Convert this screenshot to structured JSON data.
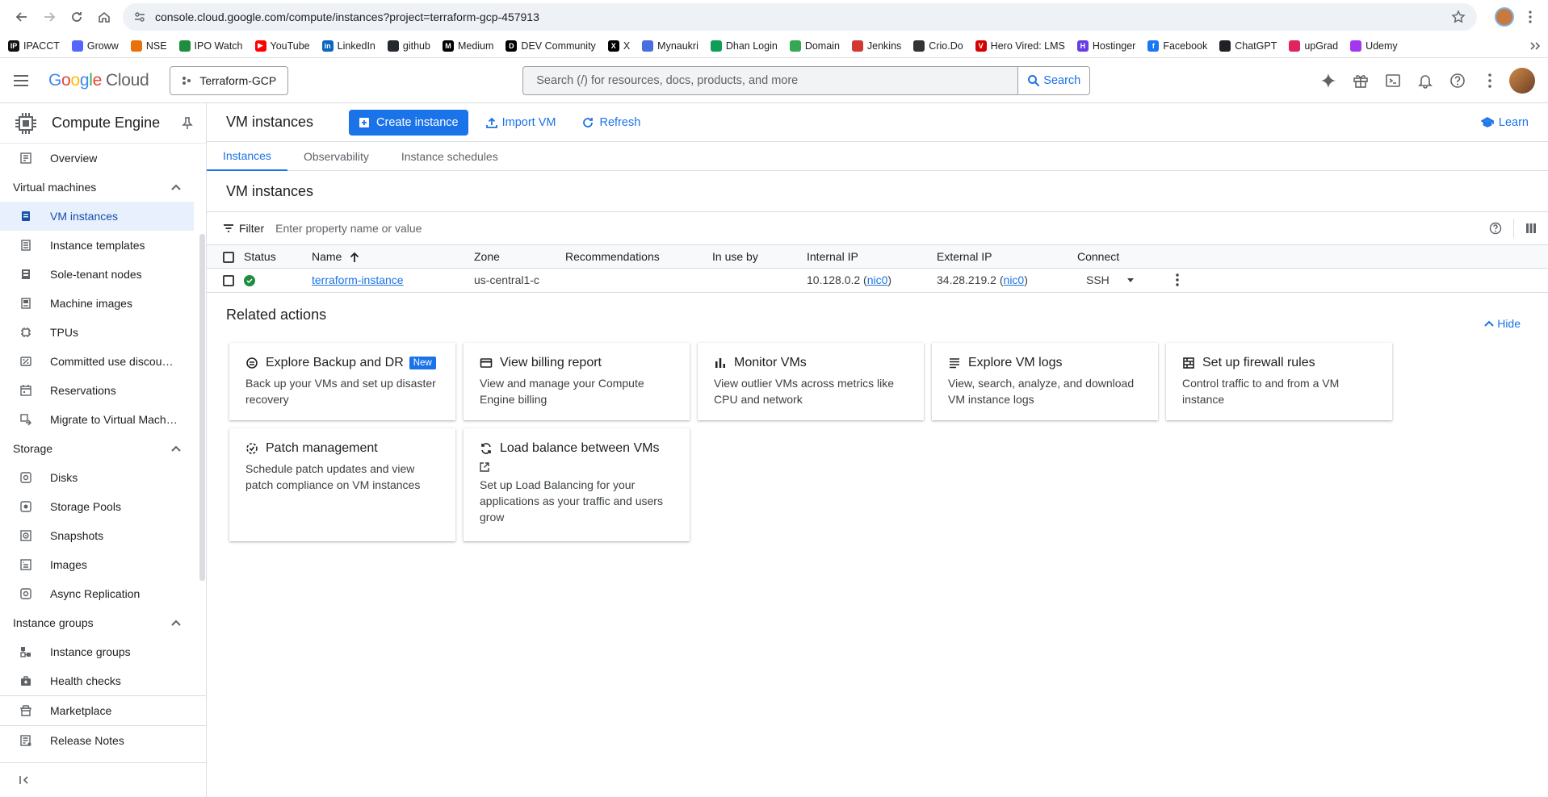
{
  "browser": {
    "url": "console.cloud.google.com/compute/instances?project=terraform-gcp-457913",
    "bookmarks": [
      {
        "label": "IPACCT",
        "color": "#111111",
        "glyph": "IP"
      },
      {
        "label": "Groww",
        "color": "#5367ff",
        "glyph": ""
      },
      {
        "label": "NSE",
        "color": "#e8710a",
        "glyph": ""
      },
      {
        "label": "IPO Watch",
        "color": "#1e8e3e",
        "glyph": ""
      },
      {
        "label": "YouTube",
        "color": "#ff0000",
        "glyph": "▶"
      },
      {
        "label": "LinkedIn",
        "color": "#0a66c2",
        "glyph": "in"
      },
      {
        "label": "github",
        "color": "#24292f",
        "glyph": ""
      },
      {
        "label": "Medium",
        "color": "#000000",
        "glyph": "M"
      },
      {
        "label": "DEV Community",
        "color": "#000000",
        "glyph": "D"
      },
      {
        "label": "X",
        "color": "#000000",
        "glyph": "X"
      },
      {
        "label": "Mynaukri",
        "color": "#4a6ee0",
        "glyph": ""
      },
      {
        "label": "Dhan Login",
        "color": "#0f9d58",
        "glyph": ""
      },
      {
        "label": "Domain",
        "color": "#34a853",
        "glyph": ""
      },
      {
        "label": "Jenkins",
        "color": "#d33833",
        "glyph": ""
      },
      {
        "label": "Crio.Do",
        "color": "#333333",
        "glyph": ""
      },
      {
        "label": "Hero Vired: LMS",
        "color": "#d50000",
        "glyph": "V"
      },
      {
        "label": "Hostinger",
        "color": "#673de6",
        "glyph": "H"
      },
      {
        "label": "Facebook",
        "color": "#1877f2",
        "glyph": "f"
      },
      {
        "label": "ChatGPT",
        "color": "#202124",
        "glyph": ""
      },
      {
        "label": "upGrad",
        "color": "#e0245e",
        "glyph": ""
      },
      {
        "label": "Udemy",
        "color": "#a435f0",
        "glyph": ""
      }
    ]
  },
  "header": {
    "logo_google": "Google",
    "logo_cloud": "Cloud",
    "project": "Terraform-GCP",
    "search_placeholder": "Search (/) for resources, docs, products, and more",
    "search_button": "Search"
  },
  "sidebar": {
    "product": "Compute Engine",
    "overview": "Overview",
    "sections": [
      {
        "title": "Virtual machines",
        "items": [
          {
            "label": "VM instances",
            "icon": "vm-icon",
            "active": true
          },
          {
            "label": "Instance templates",
            "icon": "template-icon"
          },
          {
            "label": "Sole-tenant nodes",
            "icon": "sole-tenant-icon"
          },
          {
            "label": "Machine images",
            "icon": "machine-image-icon"
          },
          {
            "label": "TPUs",
            "icon": "tpu-icon"
          },
          {
            "label": "Committed use discou…",
            "icon": "discount-icon"
          },
          {
            "label": "Reservations",
            "icon": "calendar-icon"
          },
          {
            "label": "Migrate to Virtual Mach…",
            "icon": "migrate-icon"
          }
        ]
      },
      {
        "title": "Storage",
        "items": [
          {
            "label": "Disks",
            "icon": "disk-icon"
          },
          {
            "label": "Storage Pools",
            "icon": "storage-pool-icon"
          },
          {
            "label": "Snapshots",
            "icon": "snapshot-icon"
          },
          {
            "label": "Images",
            "icon": "image-icon"
          },
          {
            "label": "Async Replication",
            "icon": "replication-icon"
          }
        ]
      },
      {
        "title": "Instance groups",
        "items": [
          {
            "label": "Instance groups",
            "icon": "instance-group-icon"
          },
          {
            "label": "Health checks",
            "icon": "health-check-icon"
          }
        ]
      }
    ],
    "marketplace": "Marketplace",
    "release_notes": "Release Notes"
  },
  "toolbar": {
    "title": "VM instances",
    "create": "Create instance",
    "import": "Import VM",
    "refresh": "Refresh",
    "learn": "Learn"
  },
  "tabs": [
    "Instances",
    "Observability",
    "Instance schedules"
  ],
  "instances": {
    "title": "VM instances",
    "filter_label": "Filter",
    "filter_placeholder": "Enter property name or value",
    "columns": [
      "Status",
      "Name",
      "Zone",
      "Recommendations",
      "In use by",
      "Internal IP",
      "External IP",
      "Connect"
    ],
    "rows": [
      {
        "name": "terraform-instance",
        "zone": "us-central1-c",
        "recommendations": "",
        "in_use_by": "",
        "internal_ip": "10.128.0.2",
        "external_ip": "34.28.219.2",
        "nic": "nic0",
        "connect": "SSH"
      }
    ]
  },
  "related": {
    "title": "Related actions",
    "hide": "Hide",
    "new_badge": "New",
    "cards": [
      {
        "title": "Explore Backup and DR",
        "desc": "Back up your VMs and set up disaster recovery",
        "icon": "backup-icon",
        "badge": true
      },
      {
        "title": "View billing report",
        "desc": "View and manage your Compute Engine billing",
        "icon": "billing-icon"
      },
      {
        "title": "Monitor VMs",
        "desc": "View outlier VMs across metrics like CPU and network",
        "icon": "bar-chart-icon"
      },
      {
        "title": "Explore VM logs",
        "desc": "View, search, analyze, and download VM instance logs",
        "icon": "logs-icon"
      },
      {
        "title": "Set up firewall rules",
        "desc": "Control traffic to and from a VM instance",
        "icon": "firewall-icon"
      },
      {
        "title": "Patch management",
        "desc": "Schedule patch updates and view patch compliance on VM instances",
        "icon": "patch-icon"
      },
      {
        "title": "Load balance between VMs",
        "desc": "Set up Load Balancing for your applications as your traffic and users grow",
        "icon": "load-balance-icon",
        "external": true
      }
    ]
  }
}
